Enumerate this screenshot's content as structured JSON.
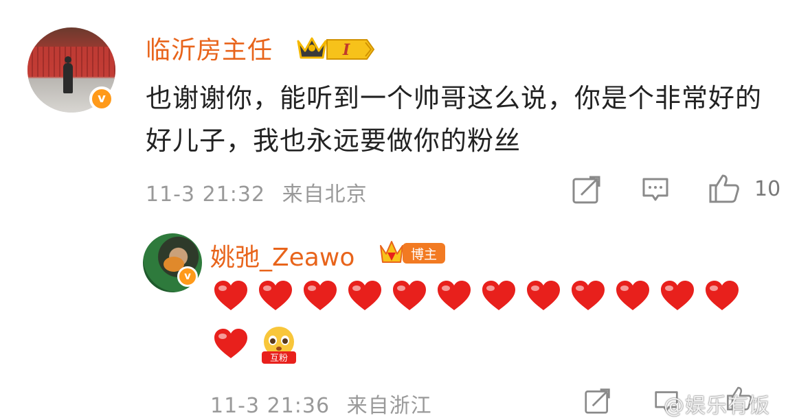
{
  "comment": {
    "username": "临沂房主任",
    "level_badge": "I",
    "text": "也谢谢你，能听到一个帅哥这么说，你是个非常好的好儿子，我也永远要做你的粉丝",
    "time": "11-3 21:32",
    "location": "来自北京",
    "likes": "10",
    "verified_mark": "v"
  },
  "reply": {
    "username": "姚弛_Zeawo",
    "role_badge": "博主",
    "heart_count": 13,
    "fan_emoji_label": "互粉",
    "time": "11-3 21:36",
    "location": "来自浙江",
    "verified_mark": "v"
  },
  "watermark": {
    "text": "@娱乐有饭"
  },
  "colors": {
    "username": "#e8641b",
    "meta": "#999999",
    "heart": "#e8201c",
    "verified": "#ff9a1a"
  }
}
